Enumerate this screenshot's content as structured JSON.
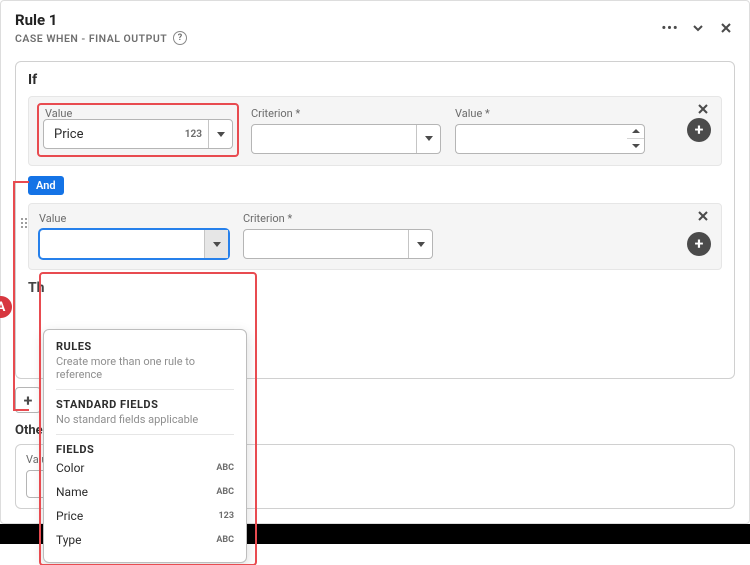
{
  "header": {
    "title": "Rule 1",
    "subtitle": "CASE WHEN - FINAL OUTPUT"
  },
  "if_section": {
    "label": "If",
    "row1": {
      "value_label": "Value",
      "criterion_label": "Criterion *",
      "value2_label": "Value *",
      "selected_value": "Price",
      "selected_badge": "123"
    },
    "and_label": "And",
    "row2": {
      "value_label": "Value",
      "criterion_label": "Criterion *"
    },
    "then_label": "Th"
  },
  "dropdown": {
    "rules_title": "RULES",
    "rules_sub": "Create more than one rule to reference",
    "standard_title": "STANDARD FIELDS",
    "standard_sub": "No standard fields applicable",
    "fields_title": "FIELDS",
    "options": [
      {
        "label": "Color",
        "type": "ABC"
      },
      {
        "label": "Name",
        "type": "ABC"
      },
      {
        "label": "Price",
        "type": "123"
      },
      {
        "label": "Type",
        "type": "ABC"
      }
    ]
  },
  "below": {
    "other_label": "Other",
    "other_value_label": "Valu"
  },
  "annotation": {
    "a": "A"
  }
}
